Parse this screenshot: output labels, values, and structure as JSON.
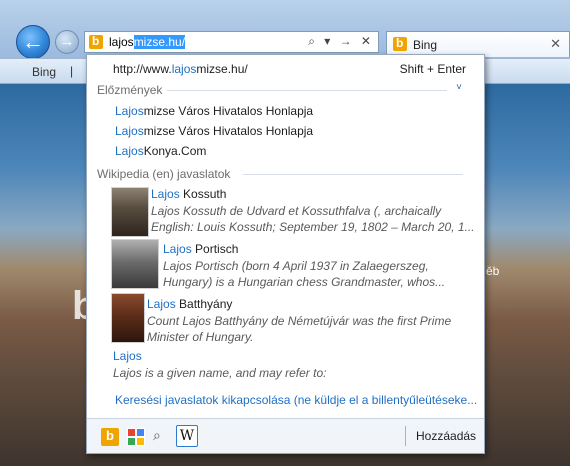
{
  "browser": {
    "address": {
      "typed": "lajos",
      "completion": "mizse.hu/"
    },
    "tab": {
      "label": "Bing"
    },
    "command_bar": {
      "bing_label": "Bing",
      "separator": "|"
    },
    "nav": {
      "back_glyph": "←",
      "forward_glyph": "→"
    },
    "address_icons": "⌕ ▾ → ✕",
    "tab_close": "✕"
  },
  "page": {
    "logo_letter": "b",
    "partial_text": "ěb"
  },
  "dropdown": {
    "url_suggestion": {
      "prefix": "http://www.",
      "match": "lajos",
      "suffix": "mizse.hu/",
      "shortcut": "Shift + Enter"
    },
    "history": {
      "header": "Előzmények",
      "items": [
        {
          "match": "Lajos",
          "rest": "mizse Város Hivatalos Honlapja"
        },
        {
          "match": "Lajos",
          "rest": "mizse Város Hivatalos Honlapja"
        },
        {
          "match": "Lajos",
          "rest": "Konya.Com"
        }
      ]
    },
    "wikipedia": {
      "header": "Wikipedia (en) javaslatok",
      "items": [
        {
          "match": "Lajos",
          "rest": " Kossuth",
          "desc1": "Lajos Kossuth de Udvard et Kossuthfalva (, archaically",
          "desc2": "English: Louis Kossuth; September 19, 1802 – March 20, 1..."
        },
        {
          "match": "Lajos",
          "rest": " Portisch",
          "desc1": "Lajos Portisch (born 4 April 1937 in Zalaegerszeg,",
          "desc2": "Hungary) is a Hungarian chess Grandmaster, whos..."
        },
        {
          "match": "Lajos",
          "rest": " Batthyány",
          "desc1": "Count Lajos Batthyány de Németújvár was the first Prime",
          "desc2": "Minister of Hungary."
        }
      ],
      "plain_item": {
        "title": "Lajos",
        "desc": "Lajos is a given name, and may refer to:"
      }
    },
    "disable_link": "Keresési javaslatok kikapcsolása (ne küldje el a billentyűleütéseke...",
    "footer": {
      "add_label": "Hozzáadás",
      "wiki_glyph": "W",
      "search_glyph": "⌕"
    }
  },
  "colors": {
    "highlight": "#1f6fc5",
    "selection": "#3399ff",
    "bing_orange": "#f0a400"
  }
}
